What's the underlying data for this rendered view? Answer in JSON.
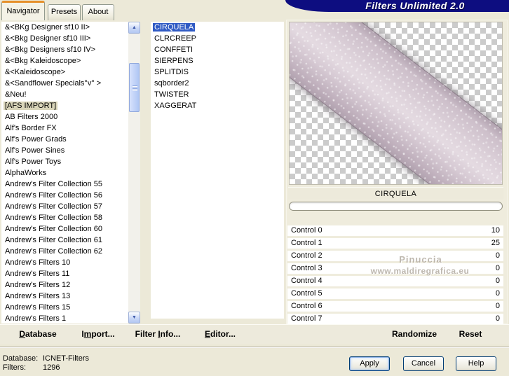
{
  "window": {
    "brand_title": "Filters Unlimited 2.0"
  },
  "tabs": [
    {
      "label": "Navigator",
      "active": true
    },
    {
      "label": "Presets",
      "active": false
    },
    {
      "label": "About",
      "active": false
    }
  ],
  "category_list": {
    "items": [
      {
        "label": "&<BKg Designer sf10 II>",
        "selected": false
      },
      {
        "label": "&<Bkg Designer sf10 III>",
        "selected": false
      },
      {
        "label": "&<Bkg Designers sf10 IV>",
        "selected": false
      },
      {
        "label": "&<Bkg Kaleidoscope>",
        "selected": false
      },
      {
        "label": "&<Kaleidoscope>",
        "selected": false
      },
      {
        "label": "&<Sandflower Specials°v° >",
        "selected": false
      },
      {
        "label": "&Neu!",
        "selected": false
      },
      {
        "label": "[AFS IMPORT]",
        "selected": true
      },
      {
        "label": "AB Filters 2000",
        "selected": false
      },
      {
        "label": "Alf's Border FX",
        "selected": false
      },
      {
        "label": "Alf's Power Grads",
        "selected": false
      },
      {
        "label": "Alf's Power Sines",
        "selected": false
      },
      {
        "label": "Alf's Power Toys",
        "selected": false
      },
      {
        "label": "AlphaWorks",
        "selected": false
      },
      {
        "label": "Andrew's Filter Collection 55",
        "selected": false
      },
      {
        "label": "Andrew's Filter Collection 56",
        "selected": false
      },
      {
        "label": "Andrew's Filter Collection 57",
        "selected": false
      },
      {
        "label": "Andrew's Filter Collection 58",
        "selected": false
      },
      {
        "label": "Andrew's Filter Collection 60",
        "selected": false
      },
      {
        "label": "Andrew's Filter Collection 61",
        "selected": false
      },
      {
        "label": "Andrew's Filter Collection 62",
        "selected": false
      },
      {
        "label": "Andrew's Filters 10",
        "selected": false
      },
      {
        "label": "Andrew's Filters 11",
        "selected": false
      },
      {
        "label": "Andrew's Filters 12",
        "selected": false
      },
      {
        "label": "Andrew's Filters 13",
        "selected": false
      },
      {
        "label": "Andrew's Filters 15",
        "selected": false
      },
      {
        "label": "Andrew's Filters 1",
        "selected": false
      }
    ]
  },
  "filter_list": {
    "items": [
      {
        "label": "CIRQUELA",
        "selected": true
      },
      {
        "label": "CLRCREEP",
        "selected": false
      },
      {
        "label": "CONFFETI",
        "selected": false
      },
      {
        "label": "SIERPENS",
        "selected": false
      },
      {
        "label": "SPLITDIS",
        "selected": false
      },
      {
        "label": "sqborder2",
        "selected": false
      },
      {
        "label": "TWISTER",
        "selected": false
      },
      {
        "label": "XAGGERAT",
        "selected": false
      }
    ]
  },
  "preview": {
    "selected_filter_name": "CIRQUELA",
    "progress_value": 0
  },
  "controls": {
    "rows": [
      {
        "label": "Control 0",
        "value": "10"
      },
      {
        "label": "Control 1",
        "value": "25"
      },
      {
        "label": "Control 2",
        "value": "0"
      },
      {
        "label": "Control 3",
        "value": "0"
      },
      {
        "label": "Control 4",
        "value": "0"
      },
      {
        "label": "Control 5",
        "value": "0"
      },
      {
        "label": "Control 6",
        "value": "0"
      },
      {
        "label": "Control 7",
        "value": "0"
      }
    ]
  },
  "watermark": {
    "line1": "Pinuccia",
    "line2": "www.maldiregrafica.eu"
  },
  "toolbar": {
    "database": {
      "pre": "",
      "key": "D",
      "post": "atabase"
    },
    "import": {
      "pre": "I",
      "key": "m",
      "post": "port..."
    },
    "filter_info": {
      "pre": "Filter ",
      "key": "I",
      "post": "nfo..."
    },
    "editor": {
      "pre": "",
      "key": "E",
      "post": "ditor..."
    },
    "randomize": "Randomize",
    "reset": "Reset"
  },
  "status": {
    "database_label": "Database:",
    "database_value": "ICNET-Filters",
    "filters_label": "Filters:",
    "filters_value": "1296"
  },
  "action_buttons": {
    "apply": "Apply",
    "cancel": "Cancel",
    "help": "Help"
  },
  "icons": {
    "scroll_up": "chevron-up-icon",
    "scroll_down": "chevron-down-icon"
  },
  "colors": {
    "dialog_bg": "#ECE9D8",
    "banner_bg": "#0D0D80",
    "active_tab_stripe": "#E5902A",
    "selection_active_bg": "#2F5AC4",
    "selection_inactive_bg": "#D9D5B9",
    "list_bg": "#FFFFFF",
    "preview_band_tint": "#D8CBD5"
  }
}
